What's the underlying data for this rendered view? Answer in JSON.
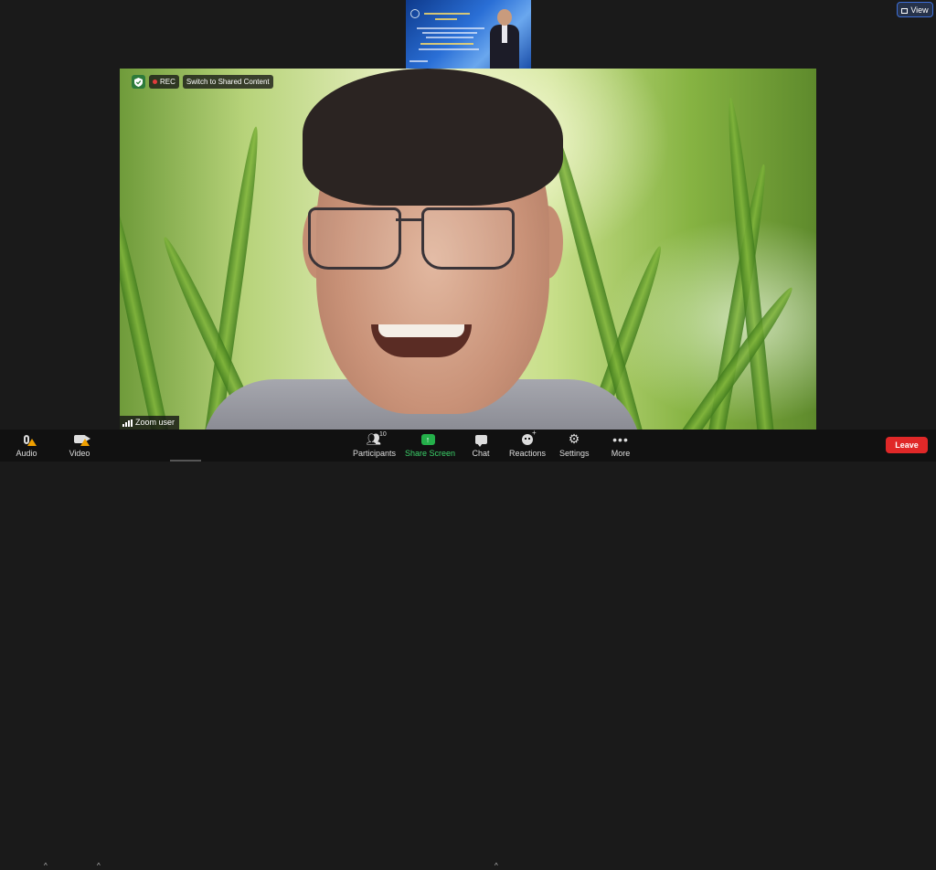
{
  "top_right": {
    "view_label": "View"
  },
  "video": {
    "badges": {
      "rec_label": "REC",
      "switch_label": "Switch to Shared Content"
    },
    "participant_name": "Zoom user"
  },
  "toolbar": {
    "audio_label": "Audio",
    "video_label": "Video",
    "participants_label": "Participants",
    "participants_count": "10",
    "share_label": "Share Screen",
    "chat_label": "Chat",
    "reactions_label": "Reactions",
    "settings_label": "Settings",
    "more_label": "More",
    "leave_label": "Leave"
  },
  "icons": {
    "audio": "microphone-icon",
    "video": "video-camera-icon",
    "participants": "people-icon",
    "share": "share-screen-icon",
    "chat": "chat-bubble-icon",
    "reactions": "smile-icon",
    "settings": "gear-icon",
    "more": "ellipsis-icon"
  },
  "colors": {
    "leave": "#e02828",
    "share_accent": "#24b04a",
    "warning": "#f0a000",
    "rec_dot": "#e23c3c",
    "view_border": "#3d6ed6"
  }
}
